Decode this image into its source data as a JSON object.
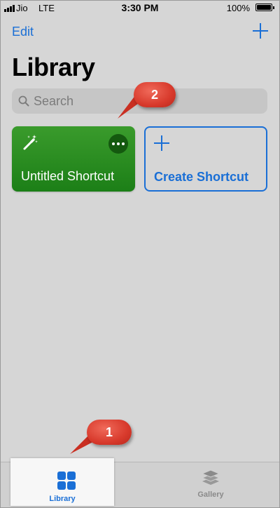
{
  "status_bar": {
    "carrier": "Jio",
    "network": "LTE",
    "time": "3:30 PM",
    "battery": "100%"
  },
  "nav": {
    "edit_label": "Edit",
    "add_icon": "plus-icon"
  },
  "page": {
    "title": "Library"
  },
  "search": {
    "placeholder": "Search",
    "icon": "magnifying-glass-icon"
  },
  "shortcuts": [
    {
      "label": "Untitled Shortcut",
      "icon": "magic-wand-icon",
      "color": "#2a8c22",
      "menu_icon": "more-icon"
    },
    {
      "label": "Create Shortcut",
      "icon": "plus-icon",
      "color": "#1a6fd6"
    }
  ],
  "callouts": [
    {
      "number": "1"
    },
    {
      "number": "2"
    }
  ],
  "tab_bar": {
    "tabs": [
      {
        "label": "Library",
        "icon": "grid-icon",
        "selected": true
      },
      {
        "label": "Gallery",
        "icon": "layers-icon",
        "selected": false
      }
    ]
  },
  "colors": {
    "accent": "#1a6fd6",
    "background": "#d6d6d6",
    "callout": "#d83a2c"
  }
}
